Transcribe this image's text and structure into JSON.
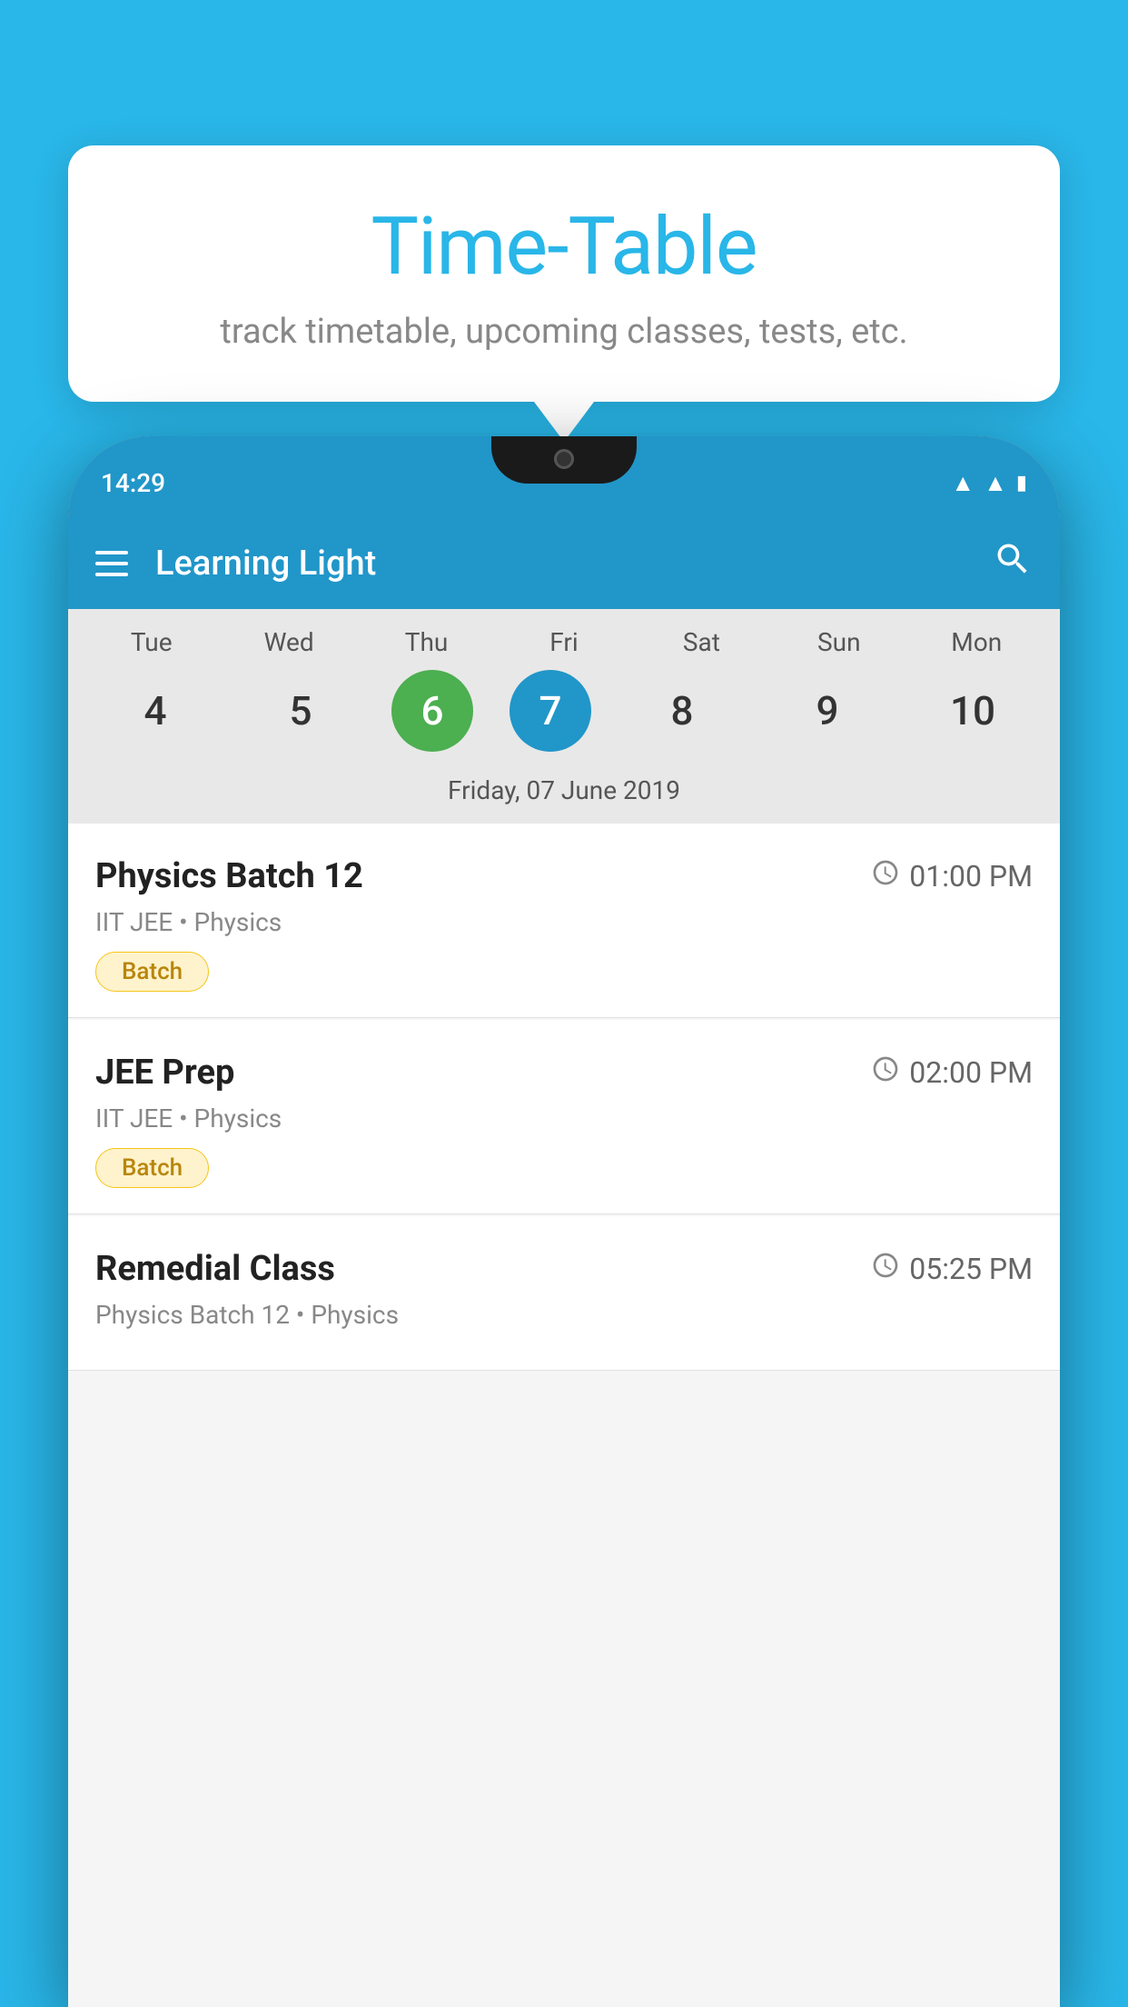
{
  "background": {
    "color": "#29B6E8"
  },
  "tooltip": {
    "title": "Time-Table",
    "subtitle": "track timetable, upcoming classes, tests, etc."
  },
  "phone": {
    "status_bar": {
      "time": "14:29",
      "icons": [
        "wifi",
        "signal",
        "battery"
      ]
    },
    "toolbar": {
      "title": "Learning Light",
      "menu_label": "menu",
      "search_label": "search"
    },
    "calendar": {
      "days": [
        {
          "label": "Tue",
          "number": "4"
        },
        {
          "label": "Wed",
          "number": "5"
        },
        {
          "label": "Thu",
          "number": "6",
          "state": "today"
        },
        {
          "label": "Fri",
          "number": "7",
          "state": "selected"
        },
        {
          "label": "Sat",
          "number": "8"
        },
        {
          "label": "Sun",
          "number": "9"
        },
        {
          "label": "Mon",
          "number": "10"
        }
      ],
      "selected_date_label": "Friday, 07 June 2019"
    },
    "schedule": {
      "items": [
        {
          "title": "Physics Batch 12",
          "time": "01:00 PM",
          "subtitle": "IIT JEE • Physics",
          "badge": "Batch"
        },
        {
          "title": "JEE Prep",
          "time": "02:00 PM",
          "subtitle": "IIT JEE • Physics",
          "badge": "Batch"
        },
        {
          "title": "Remedial Class",
          "time": "05:25 PM",
          "subtitle": "Physics Batch 12 • Physics",
          "badge": null
        }
      ]
    }
  }
}
